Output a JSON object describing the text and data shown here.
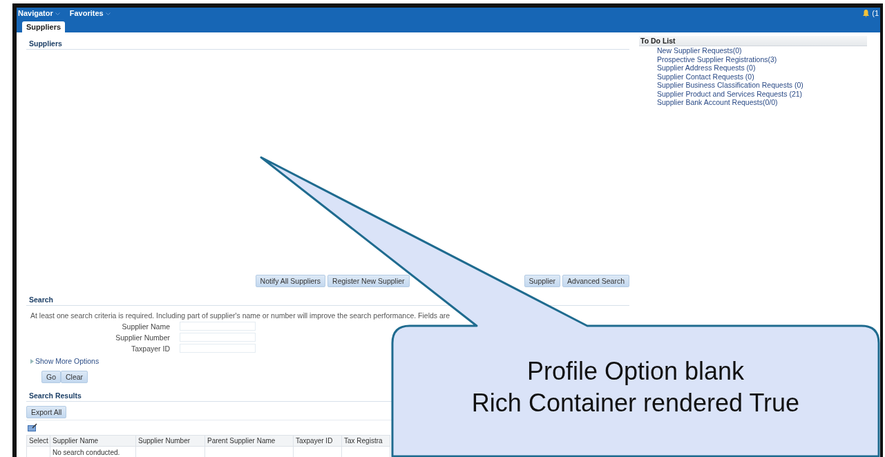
{
  "top_nav": {
    "menus": [
      {
        "label": "Navigator"
      },
      {
        "label": "Favorites"
      }
    ],
    "notification_count": "(1"
  },
  "tabs": [
    {
      "label": "Suppliers",
      "selected": true
    }
  ],
  "suppliers_panel": {
    "title": "Suppliers",
    "buttons": [
      "Notify All Suppliers",
      "Register New Supplier",
      "Supplier",
      "Advanced Search"
    ]
  },
  "todo": {
    "title": "To Do List",
    "items": [
      "New Supplier Requests(0)",
      "Prospective Supplier Registrations(3)",
      "Supplier Address Requests (0)",
      "Supplier Contact Requests (0)",
      "Supplier Business Classification Requests (0)",
      "Supplier Product and Services Requests (21)",
      "Supplier Bank Account Requests(0/0)"
    ]
  },
  "search": {
    "title": "Search",
    "hint": "At least one search criteria is required. Including part of supplier's name or number will improve the search performance. Fields are",
    "fields": [
      {
        "label": "Supplier Name"
      },
      {
        "label": "Supplier Number"
      },
      {
        "label": "Taxpayer ID"
      }
    ],
    "more_options": "Show More Options",
    "buttons": [
      "Go",
      "Clear"
    ]
  },
  "results": {
    "title": "Search Results",
    "export_button": "Export All",
    "columns": [
      "Select",
      "Supplier Name",
      "Supplier Number",
      "Parent Supplier Name",
      "Taxpayer ID",
      "Tax Registra"
    ],
    "empty_message": "No search conducted."
  },
  "callout": {
    "lines": [
      "Profile Option blank",
      "Rich Container rendered True"
    ]
  }
}
